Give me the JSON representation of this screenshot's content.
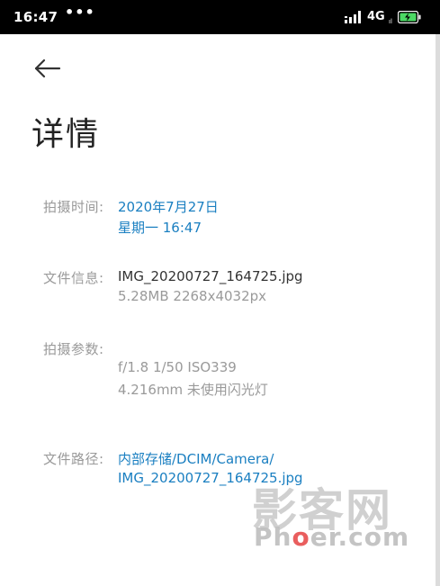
{
  "status_bar": {
    "time": "16:47",
    "dots": "•••",
    "network": "4G",
    "network_sub": "ıl"
  },
  "page": {
    "title": "详情"
  },
  "details": {
    "shoot_time": {
      "label": "拍摄时间:",
      "date": "2020年7月27日",
      "weekday_time": "星期一    16:47"
    },
    "file_info": {
      "label": "文件信息:",
      "filename": "IMG_20200727_164725.jpg",
      "size_resolution": "5.28MB    2268x4032px"
    },
    "shoot_params": {
      "label": "拍摄参数:",
      "exposure": "f/1.8     1/50     ISO339",
      "focal_flash": "4.216mm     未使用闪光灯"
    },
    "file_path": {
      "label": "文件路径:",
      "path_line1": "内部存储/DCIM/Camera/",
      "path_line2": "IMG_20200727_164725.jpg"
    }
  },
  "watermark": {
    "cn": "影客网",
    "en_part1": "Ph",
    "en_o": "o",
    "en_part2": "er.com"
  },
  "colors": {
    "link_blue": "#1a7fc1",
    "label_gray": "#9a9a9a",
    "value_dark": "#333333"
  }
}
